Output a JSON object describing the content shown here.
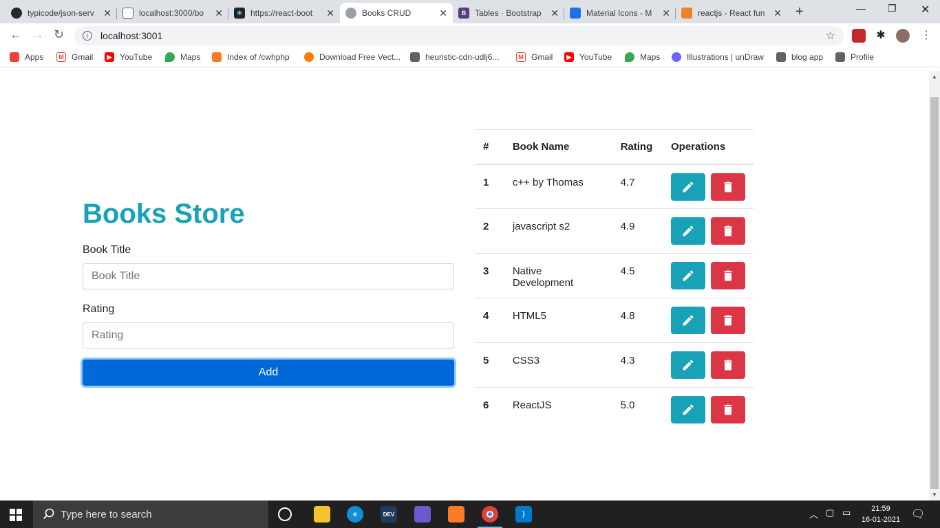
{
  "browser": {
    "tabs": [
      {
        "title": "typicode/json-serv",
        "favicon": "github-icon",
        "color": "#24292e"
      },
      {
        "title": "localhost:3000/bo",
        "favicon": "page-icon",
        "color": "#5f6368"
      },
      {
        "title": "https://react-boot",
        "favicon": "react-bootstrap-icon",
        "color": "#20232a"
      },
      {
        "title": "Books CRUD",
        "favicon": "globe-icon",
        "color": "#5f6368",
        "active": true
      },
      {
        "title": "Tables · Bootstrap",
        "favicon": "bootstrap-icon",
        "color": "#563d7c"
      },
      {
        "title": "Material Icons - M",
        "favicon": "material-icon",
        "color": "#1a73e8"
      },
      {
        "title": "reactjs - React fun",
        "favicon": "stackoverflow-icon",
        "color": "#f48024"
      }
    ],
    "url": "localhost:3001",
    "bookmarks": [
      {
        "label": "Apps",
        "icon": "apps-grid-icon",
        "color": "#ea4335"
      },
      {
        "label": "Gmail",
        "icon": "gmail-icon",
        "color": "#ea4335"
      },
      {
        "label": "YouTube",
        "icon": "youtube-icon",
        "color": "#ff0000"
      },
      {
        "label": "Maps",
        "icon": "maps-pin-icon",
        "color": "#34a853"
      },
      {
        "label": "Index of /cwhphp",
        "icon": "xampp-icon",
        "color": "#fb7a24"
      },
      {
        "label": "Download Free Vect...",
        "icon": "vecteezy-icon",
        "color": "#ff7c00"
      },
      {
        "label": "heuristic-cdn-udlj6...",
        "icon": "cube-icon",
        "color": "#5f6368"
      },
      {
        "label": "Gmail",
        "icon": "gmail-icon",
        "color": "#ea4335"
      },
      {
        "label": "YouTube",
        "icon": "youtube-icon",
        "color": "#ff0000"
      },
      {
        "label": "Maps",
        "icon": "maps-pin-icon",
        "color": "#34a853"
      },
      {
        "label": "Illustrations | unDraw",
        "icon": "undraw-icon",
        "color": "#6c63ff"
      },
      {
        "label": "blog app",
        "icon": "cube-icon",
        "color": "#5f6368"
      },
      {
        "label": "Profile",
        "icon": "cube-icon",
        "color": "#5f6368"
      }
    ]
  },
  "app": {
    "title": "Books Store",
    "form": {
      "title_label": "Book Title",
      "title_placeholder": "Book Title",
      "rating_label": "Rating",
      "rating_placeholder": "Rating",
      "add_label": "Add"
    },
    "table": {
      "headers": [
        "#",
        "Book Name",
        "Rating",
        "Operations"
      ],
      "rows": [
        {
          "id": "1",
          "name": "c++ by Thomas",
          "rating": "4.7"
        },
        {
          "id": "2",
          "name": "javascript s2",
          "rating": "4.9"
        },
        {
          "id": "3",
          "name": "Native Development",
          "rating": "4.5"
        },
        {
          "id": "4",
          "name": "HTML5",
          "rating": "4.8"
        },
        {
          "id": "5",
          "name": "CSS3",
          "rating": "4.3"
        },
        {
          "id": "6",
          "name": "ReactJS",
          "rating": "5.0"
        }
      ],
      "edit_icon": "pencil-icon",
      "delete_icon": "trash-icon",
      "edit_color": "#17a2b8",
      "delete_color": "#dc3545"
    },
    "accent_color": "#17a2b8",
    "button_color": "#0069d9"
  },
  "taskbar": {
    "search_placeholder": "Type here to search",
    "time": "21:59",
    "date": "16-01-2021"
  }
}
